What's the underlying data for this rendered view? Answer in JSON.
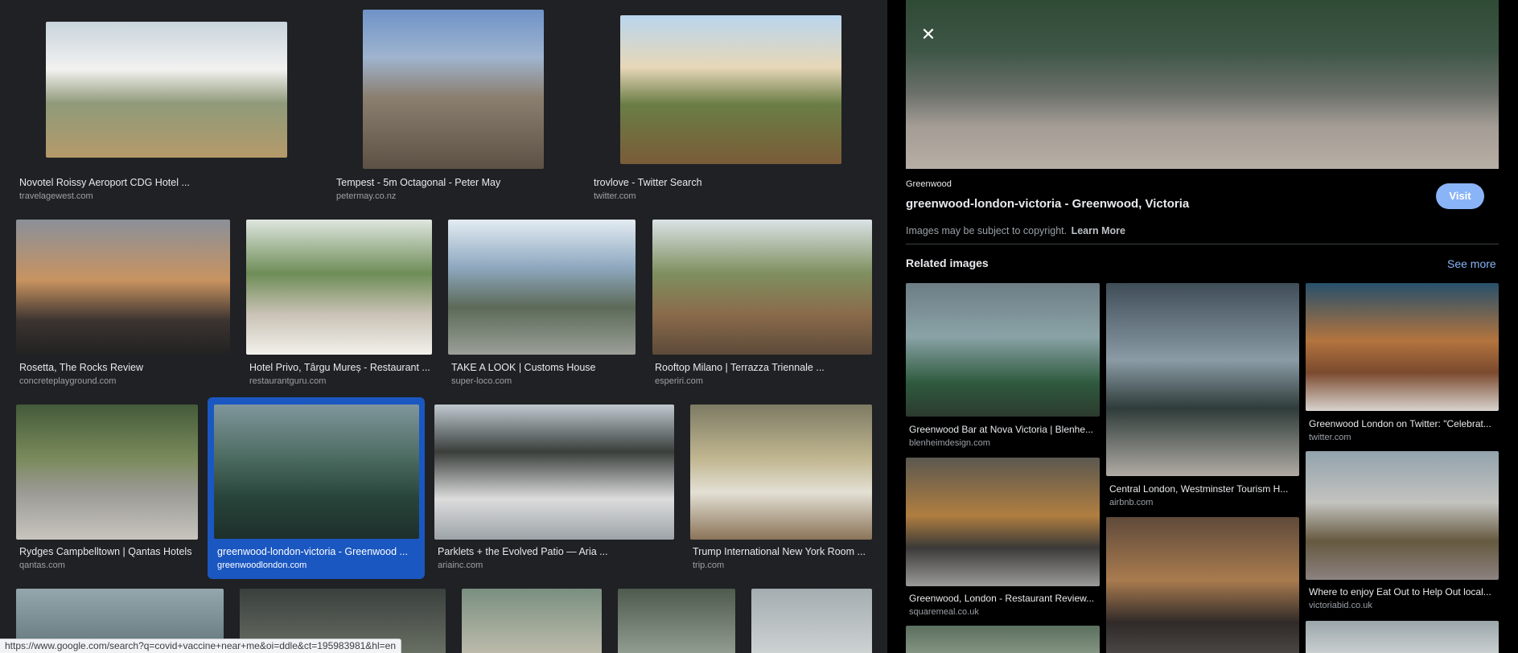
{
  "results": [
    {
      "caption": "Novotel Roissy Aeroport CDG Hotel ...",
      "source": "travelagewest.com"
    },
    {
      "caption": "Tempest - 5m Octagonal - Peter May",
      "source": "petermay.co.nz"
    },
    {
      "caption": "trovlove - Twitter Search",
      "source": "twitter.com"
    },
    {
      "caption": "Rosetta, The Rocks Review",
      "source": "concreteplayground.com"
    },
    {
      "caption": "Hotel Privo, Târgu Mureș - Restaurant ...",
      "source": "restaurantguru.com"
    },
    {
      "caption": "TAKE A LOOK | Customs House",
      "source": "super-loco.com"
    },
    {
      "caption": "Rooftop Milano | Terrazza Triennale ...",
      "source": "esperiri.com"
    },
    {
      "caption": "Rydges Campbelltown | Qantas Hotels",
      "source": "qantas.com"
    },
    {
      "caption": "greenwood-london-victoria - Greenwood ...",
      "source": "greenwoodlondon.com"
    },
    {
      "caption": "Parklets + the Evolved Patio — Aria ...",
      "source": "ariainc.com"
    },
    {
      "caption": "Trump International New York Room ...",
      "source": "trip.com"
    }
  ],
  "panel": {
    "close_icon": "close-icon",
    "site_name": "Greenwood",
    "title": "greenwood-london-victoria - Greenwood, Victoria",
    "visit_label": "Visit",
    "copyright_text": "Images may be subject to copyright.",
    "learn_more_label": "Learn More",
    "related_heading": "Related images",
    "see_more_label": "See more",
    "related": [
      {
        "caption": "Greenwood Bar at Nova Victoria | Blenhe...",
        "source": "blenheimdesign.com"
      },
      {
        "caption": "Central London, Westminster Tourism H...",
        "source": "airbnb.com"
      },
      {
        "caption": "Greenwood London on Twitter: \"Celebrat...",
        "source": "twitter.com"
      },
      {
        "caption": "Greenwood, London - Restaurant Review...",
        "source": "squaremeal.co.uk"
      },
      {
        "caption": "Where to enjoy Eat Out to Help Out local...",
        "source": "victoriabid.co.uk"
      }
    ]
  },
  "status_url": "https://www.google.com/search?q=covid+vaccine+near+me&oi=ddle&ct=195983981&hl=en",
  "colors": {
    "page_bg": "#202124",
    "panel_bg": "#000000",
    "selected_bg": "#1a57c1",
    "accent": "#8ab4f8"
  }
}
